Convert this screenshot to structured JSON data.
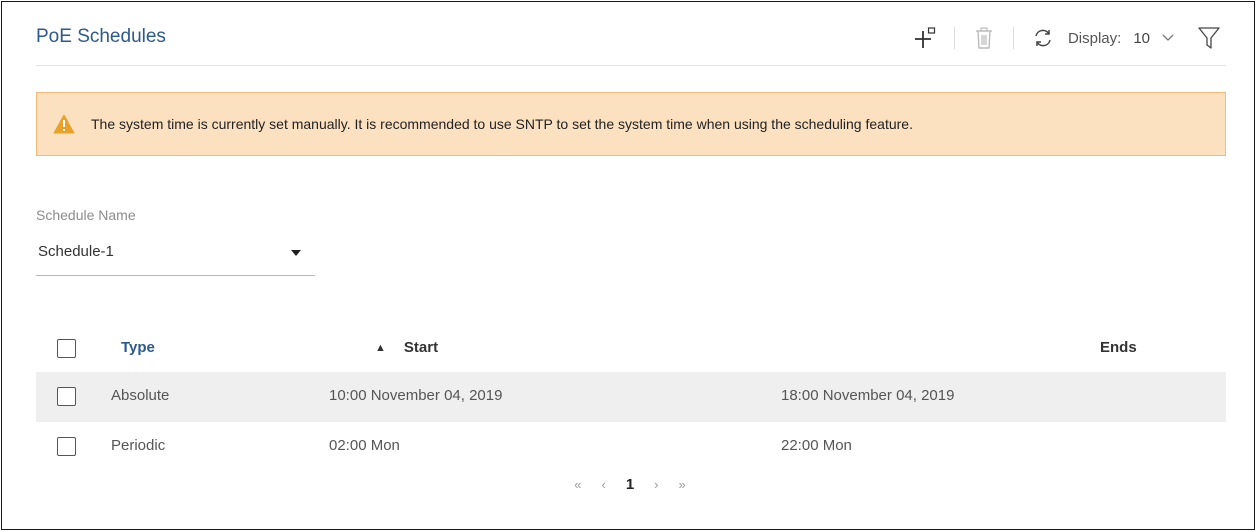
{
  "header": {
    "title": "PoE Schedules",
    "display_label": "Display:",
    "display_value": "10"
  },
  "alert": {
    "text": "The system time is currently set manually. It is recommended to use SNTP to set the system time when using the scheduling feature."
  },
  "schedule": {
    "label": "Schedule Name",
    "value": "Schedule-1"
  },
  "table": {
    "columns": {
      "type": "Type",
      "start": "Start",
      "ends": "Ends"
    },
    "sort_indicator": "▲",
    "rows": [
      {
        "type": "Absolute",
        "start": "10:00 November 04, 2019",
        "ends": "18:00 November 04, 2019"
      },
      {
        "type": "Periodic",
        "start": "02:00 Mon",
        "ends": "22:00 Mon"
      }
    ]
  },
  "pagination": {
    "first": "«",
    "prev": "‹",
    "current": "1",
    "next": "›",
    "last": "»"
  },
  "icons": {
    "add": "add-icon",
    "delete": "trash-icon",
    "refresh": "refresh-icon",
    "filter": "filter-icon",
    "warning": "warning-icon",
    "chevron": "chevron-down-icon"
  },
  "colors": {
    "title": "#2c5a8c",
    "alert_bg": "#fce1c1",
    "alert_border": "#f5b97a",
    "warning_icon": "#e8a22a",
    "row_shade": "#efefef"
  }
}
